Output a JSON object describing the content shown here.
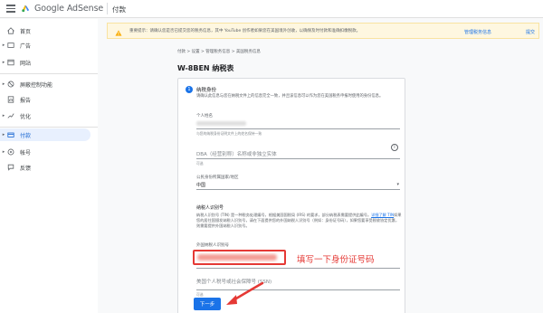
{
  "topbar": {
    "brand_google": "Google",
    "brand_product": "AdSense",
    "page_title": "付款"
  },
  "sidebar": {
    "items": [
      {
        "label": "首页",
        "icon": "home-icon",
        "caret": ""
      },
      {
        "label": "广告",
        "icon": "ads-icon",
        "caret": "▸"
      },
      {
        "label": "网站",
        "icon": "sites-icon",
        "caret": "▸"
      },
      {
        "label": "屏蔽控制功能",
        "icon": "block-icon",
        "caret": "▸"
      },
      {
        "label": "报告",
        "icon": "reports-icon",
        "caret": ""
      },
      {
        "label": "优化",
        "icon": "optimize-icon",
        "caret": "▸"
      },
      {
        "label": "付款",
        "icon": "payments-icon",
        "caret": "▸"
      },
      {
        "label": "帐号",
        "icon": "account-icon",
        "caret": "▸"
      },
      {
        "label": "反馈",
        "icon": "feedback-icon",
        "caret": ""
      }
    ]
  },
  "banner": {
    "text": "重要提示：请确认您是否已提交您的税务信息，其中 YouTube 创作者如果您在美国境外创收，以确保及时付款和准确扣缴税款。",
    "action_secondary": "管理税务信息",
    "action_primary": "提交"
  },
  "form": {
    "breadcrumb": "付款  >  设置  >  管理税务信息  >  美国税务信息",
    "title": "W-8BEN 纳税表",
    "step_number": "1",
    "step_title": "纳税身份",
    "step_desc": "请确认此信息与您在纳税文件上的信息完全一致，并且该信息可以作为您在美国税务申报时使用的身份信息。",
    "name_label": "个人姓名",
    "name_hint": "与您的纳税身份证明文件上的姓名保持一致",
    "dba_placeholder": "DBA（经营别称）名称或非独立实体",
    "dba_hint": "可选",
    "country_label": "公民身份所属国家/地区",
    "country_value": "中国",
    "country_arrow": "▾",
    "tin_section_title": "纳税人识别号",
    "tin_desc_before": "纳税人识别号 (TIN) 是一种税务处理编号，根据美国国税局 (IRS) 的要求，部分纳税表需要提供此编号。",
    "tin_link": "详细了解 TIN",
    "tin_desc_after": "如果您的居住国颁发纳税人识别号，请在下面提供您的外国纳税人识别号（例如：身份证号码），如果您要享受税收协定优惠，则需要提供外国纳税人识别号。",
    "foreign_tin_label": "外国纳税人识别号",
    "ssn_placeholder": "美国个人税号或社会保障号 (SSN)",
    "ssn_hint": "可选",
    "next_button": "下一步",
    "info_icon_glyph": "i"
  },
  "annotation": {
    "text": "填写一下身份证号码",
    "color": "#e53935"
  },
  "colors": {
    "accent": "#1a73e8",
    "warning_bg": "#fef7e0",
    "active_nav_bg": "#e8f0fe"
  }
}
